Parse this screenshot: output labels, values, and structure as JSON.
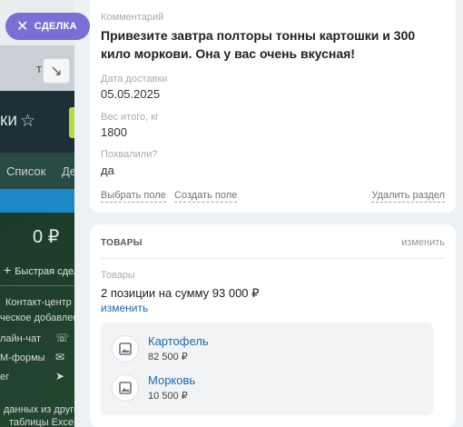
{
  "deal_tag": {
    "label": "СДЕЛКА"
  },
  "background": {
    "tab_fragment": "т",
    "title_fragment": "ки",
    "views": [
      "Список",
      "Де"
    ],
    "money": "0 ₽",
    "quick_label": "Быстрая сдел",
    "side_lines": [
      "Контакт-центр",
      "ческое добавлен",
      "лайн-чат",
      "М-формы",
      "ег",
      "данных из друго",
      "таблицы Excel"
    ]
  },
  "fields_card": {
    "comment": {
      "label": "Комментарий",
      "value": "Привезите завтра полторы тонны картошки и 300 кило моркови. Она у вас очень вкусная!"
    },
    "delivery_date": {
      "label": "Дата доставки",
      "value": "05.05.2025"
    },
    "weight": {
      "label": "Вес итого, кг",
      "value": "1800"
    },
    "praised": {
      "label": "Похвалили?",
      "value": "да"
    },
    "actions": {
      "select_field": "Выбрать поле",
      "create_field": "Создать поле",
      "delete_section": "Удалить раздел"
    }
  },
  "goods_card": {
    "title": "ТОВАРЫ",
    "edit": "изменить",
    "label": "Товары",
    "summary": "2 позиции на сумму 93 000 ₽",
    "edit_link": "изменить",
    "items": [
      {
        "name": "Картофель",
        "price": "82 500 ₽",
        "icon": "image-icon"
      },
      {
        "name": "Морковь",
        "price": "10 500 ₽",
        "icon": "image-icon"
      }
    ]
  },
  "colors": {
    "accent_link": "#2067b0",
    "deal_tag": "#7b6fd6",
    "stage_bar": "#1e88c7"
  }
}
